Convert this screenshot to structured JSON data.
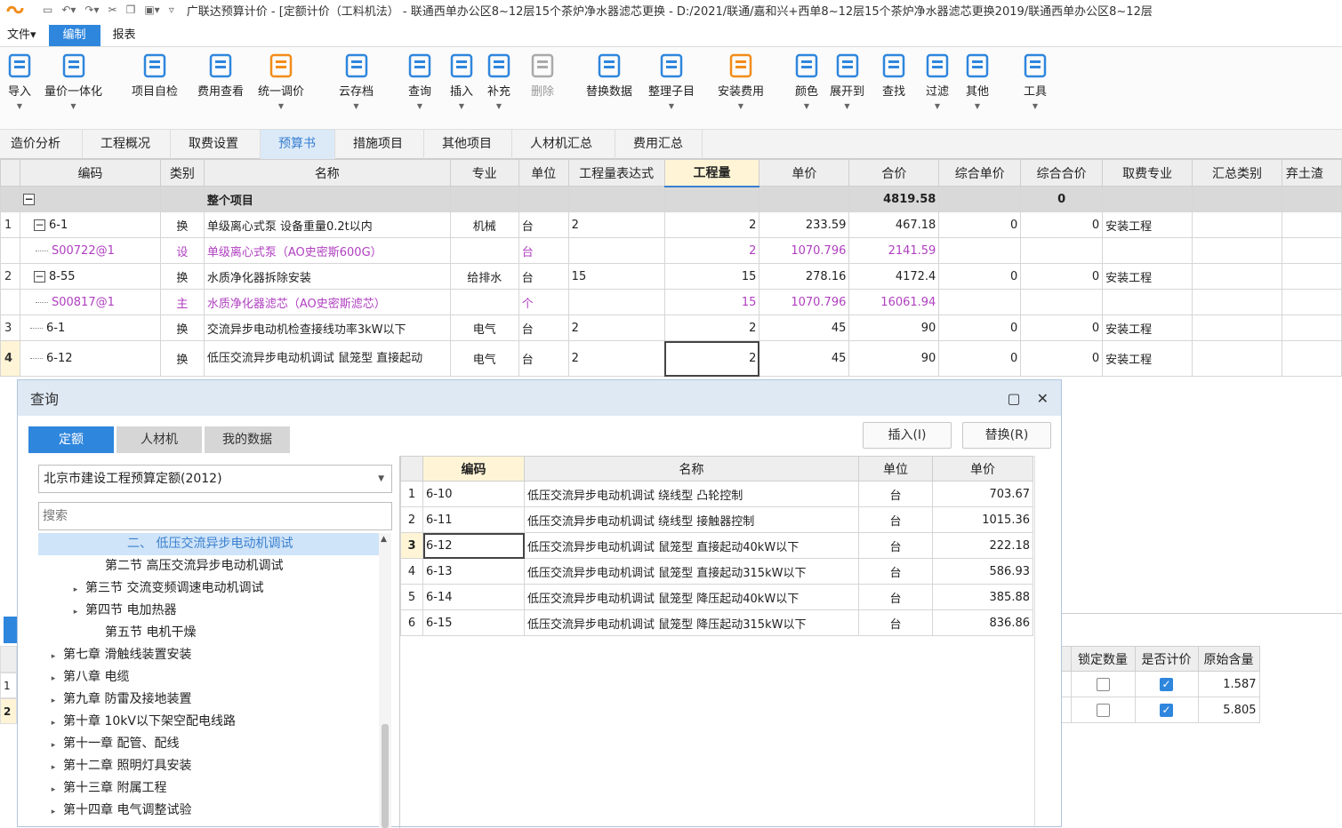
{
  "app": {
    "title": "广联达预算计价 - [定额计价（工料机法） - 联通西单办公区8~12层15个茶炉净水器滤芯更换 - D:/2021/联通/嘉和兴+西单8~12层15个茶炉净水器滤芯更换2019/联通西单办公区8~12层",
    "menu": [
      "文件▾",
      "编制",
      "报表"
    ]
  },
  "ribbon": [
    {
      "label": "导入",
      "icon": "import-icon",
      "arrow": true
    },
    {
      "label": "量价一体化",
      "icon": "quantity-price-icon",
      "arrow": true
    },
    {
      "label": "项目自检",
      "icon": "self-check-icon",
      "arrow": false
    },
    {
      "label": "费用查看",
      "icon": "fee-view-icon",
      "arrow": false
    },
    {
      "label": "统一调价",
      "icon": "adjust-price-icon",
      "arrow": true
    },
    {
      "label": "云存档",
      "icon": "cloud-save-icon",
      "arrow": true
    },
    {
      "label": "查询",
      "icon": "query-icon",
      "arrow": true
    },
    {
      "label": "插入",
      "icon": "insert-icon",
      "arrow": true
    },
    {
      "label": "补充",
      "icon": "supplement-icon",
      "arrow": true
    },
    {
      "label": "删除",
      "icon": "delete-icon",
      "arrow": false,
      "disabled": true
    },
    {
      "label": "替换数据",
      "icon": "replace-data-icon",
      "arrow": false
    },
    {
      "label": "整理子目",
      "icon": "organize-icon",
      "arrow": true
    },
    {
      "label": "安装费用",
      "icon": "install-fee-icon",
      "arrow": true
    },
    {
      "label": "颜色",
      "icon": "color-icon",
      "arrow": true
    },
    {
      "label": "展开到",
      "icon": "expand-icon",
      "arrow": true
    },
    {
      "label": "查找",
      "icon": "find-icon",
      "arrow": false
    },
    {
      "label": "过滤",
      "icon": "filter-icon",
      "arrow": true
    },
    {
      "label": "其他",
      "icon": "other-icon",
      "arrow": true
    },
    {
      "label": "工具",
      "icon": "tools-icon",
      "arrow": true
    }
  ],
  "tabs": [
    "造价分析",
    "工程概况",
    "取费设置",
    "预算书",
    "措施项目",
    "其他项目",
    "人材机汇总",
    "费用汇总"
  ],
  "grid": {
    "headers": [
      "编码",
      "类别",
      "名称",
      "专业",
      "单位",
      "工程量表达式",
      "工程量",
      "单价",
      "合价",
      "综合单价",
      "综合合价",
      "取费专业",
      "汇总类别",
      "弃土渣"
    ],
    "total": {
      "name": "整个项目",
      "total_price": "4819.58",
      "composite_total": "0"
    },
    "rows": [
      {
        "num": "1",
        "code": "6-1",
        "type": "换",
        "name": "单级离心式泵 设备重量0.2t以内",
        "major": "机械",
        "unit": "台",
        "expr": "2",
        "qty": "2",
        "price": "233.59",
        "total": "467.18",
        "cprice": "0",
        "ctotal": "0",
        "fee": "安装工程"
      },
      {
        "num": "",
        "code": "S00722@1",
        "type": "设",
        "name": "单级离心式泵（AO史密斯600G）",
        "major": "",
        "unit": "台",
        "expr": "",
        "qty": "2",
        "price": "1070.796",
        "total": "2141.59",
        "cprice": "",
        "ctotal": "",
        "fee": ""
      },
      {
        "num": "2",
        "code": "8-55",
        "type": "换",
        "name": "水质净化器拆除安装",
        "major": "给排水",
        "unit": "台",
        "expr": "15",
        "qty": "15",
        "price": "278.16",
        "total": "4172.4",
        "cprice": "0",
        "ctotal": "0",
        "fee": "安装工程"
      },
      {
        "num": "",
        "code": "S00817@1",
        "type": "主",
        "name": "水质净化器滤芯（AO史密斯滤芯）",
        "major": "",
        "unit": "个",
        "expr": "",
        "qty": "15",
        "price": "1070.796",
        "total": "16061.94",
        "cprice": "",
        "ctotal": "",
        "fee": ""
      },
      {
        "num": "3",
        "code": "6-1",
        "type": "换",
        "name": "交流异步电动机检查接线功率3kW以下",
        "major": "电气",
        "unit": "台",
        "expr": "2",
        "qty": "2",
        "price": "45",
        "total": "90",
        "cprice": "0",
        "ctotal": "0",
        "fee": "安装工程"
      },
      {
        "num": "4",
        "code": "6-12",
        "type": "换",
        "name": "低压交流异步电动机调试 鼠笼型 直接起动",
        "major": "电气",
        "unit": "台",
        "expr": "2",
        "qty": "2",
        "price": "45",
        "total": "90",
        "cprice": "0",
        "ctotal": "0",
        "fee": "安装工程"
      }
    ]
  },
  "dialog": {
    "title": "查询",
    "tabs": [
      "定额",
      "人材机",
      "我的数据"
    ],
    "insert_label": "插入(I)",
    "replace_label": "替换(R)",
    "library": "北京市建设工程预算定额(2012)",
    "search_placeholder": "搜索",
    "tree": [
      {
        "label": "二、 低压交流异步电动机调试",
        "indent": 100,
        "tri": "",
        "selected": true
      },
      {
        "label": "第二节 高压交流异步电动机调试",
        "indent": 75,
        "tri": ""
      },
      {
        "label": "第三节 交流变频调速电动机调试",
        "indent": 53,
        "tri": "▸"
      },
      {
        "label": "第四节 电加热器",
        "indent": 53,
        "tri": "▸"
      },
      {
        "label": "第五节 电机干燥",
        "indent": 75,
        "tri": ""
      },
      {
        "label": "第七章 滑触线装置安装",
        "indent": 28,
        "tri": "▸"
      },
      {
        "label": "第八章 电缆",
        "indent": 28,
        "tri": "▸"
      },
      {
        "label": "第九章 防雷及接地装置",
        "indent": 28,
        "tri": "▸"
      },
      {
        "label": "第十章 10kV以下架空配电线路",
        "indent": 28,
        "tri": "▸"
      },
      {
        "label": "第十一章 配管、配线",
        "indent": 28,
        "tri": "▸"
      },
      {
        "label": "第十二章 照明灯具安装",
        "indent": 28,
        "tri": "▸"
      },
      {
        "label": "第十三章 附属工程",
        "indent": 28,
        "tri": "▸"
      },
      {
        "label": "第十四章 电气调整试验",
        "indent": 28,
        "tri": "▸"
      }
    ],
    "results_headers": [
      "编码",
      "名称",
      "单位",
      "单价"
    ],
    "results": [
      {
        "n": "1",
        "code": "6-10",
        "name": "低压交流异步电动机调试 绕线型 凸轮控制",
        "unit": "台",
        "price": "703.67"
      },
      {
        "n": "2",
        "code": "6-11",
        "name": "低压交流异步电动机调试 绕线型 接触器控制",
        "unit": "台",
        "price": "1015.36"
      },
      {
        "n": "3",
        "code": "6-12",
        "name": "低压交流异步电动机调试 鼠笼型 直接起动40kW以下",
        "unit": "台",
        "price": "222.18"
      },
      {
        "n": "4",
        "code": "6-13",
        "name": "低压交流异步电动机调试 鼠笼型 直接起动315kW以下",
        "unit": "台",
        "price": "586.93"
      },
      {
        "n": "5",
        "code": "6-14",
        "name": "低压交流异步电动机调试 鼠笼型 降压起动40kW以下",
        "unit": "台",
        "price": "385.88"
      },
      {
        "n": "6",
        "code": "6-15",
        "name": "低压交流异步电动机调试 鼠笼型 降压起动315kW以下",
        "unit": "台",
        "price": "836.86"
      }
    ]
  },
  "behind": {
    "headers": [
      "锁定数量",
      "是否计价",
      "原始含量"
    ],
    "rows": [
      {
        "n": "1",
        "locked": false,
        "priced": true,
        "orig": "1.587"
      },
      {
        "n": "2",
        "locked": false,
        "priced": true,
        "orig": "5.805"
      }
    ]
  }
}
